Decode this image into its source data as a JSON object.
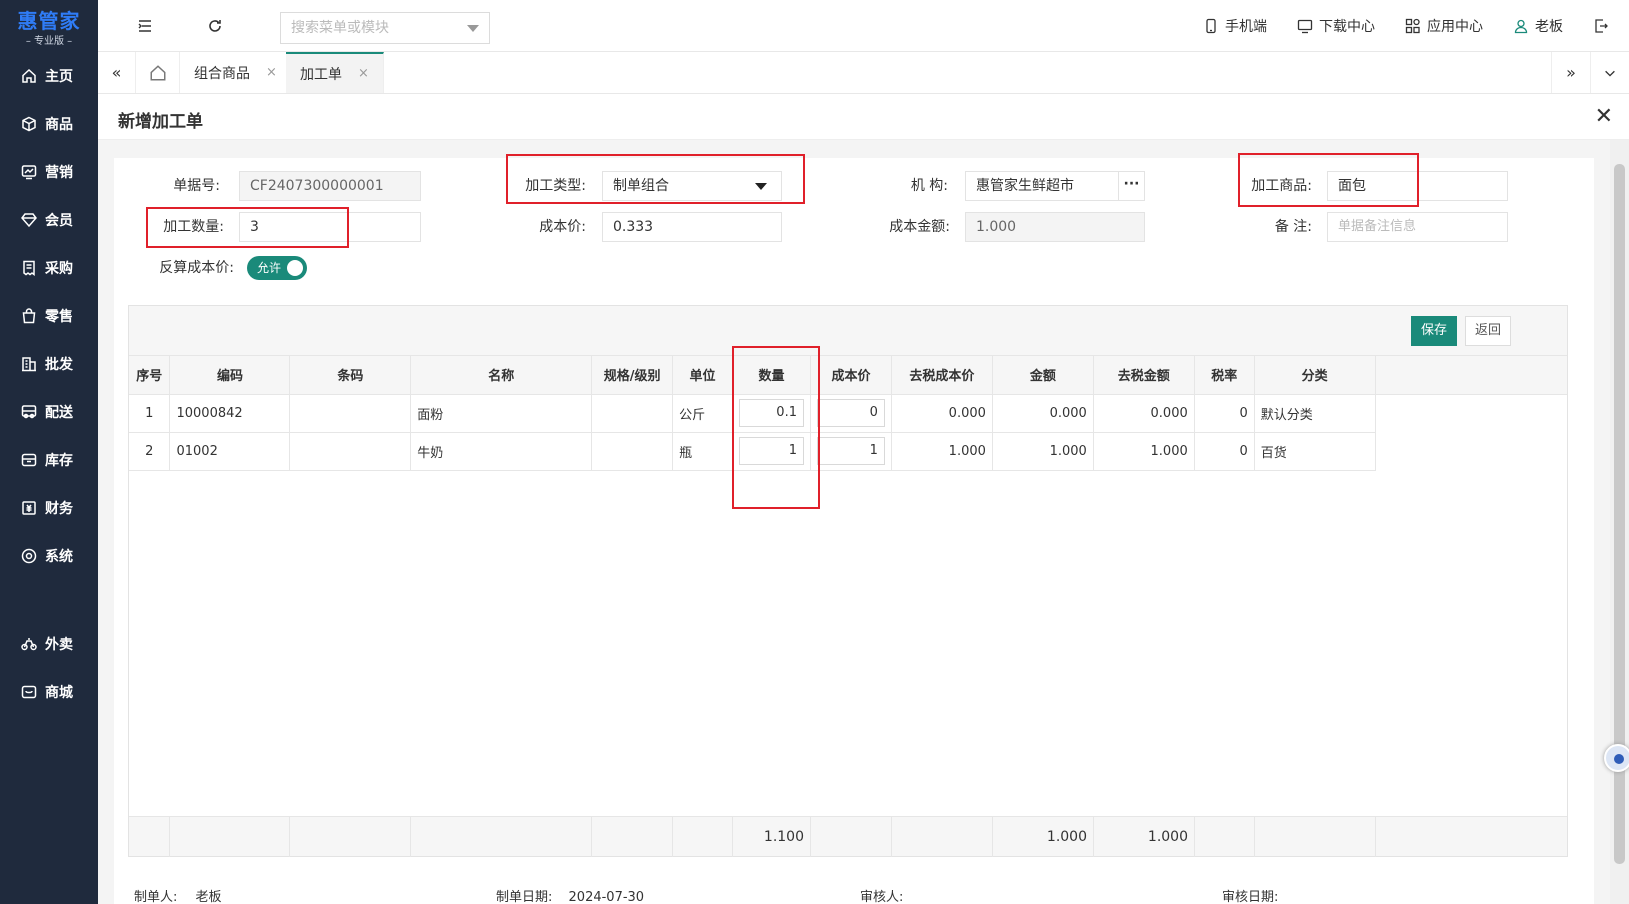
{
  "app": {
    "logo_main": "惠管家",
    "logo_sub": "专业版"
  },
  "sidebar": {
    "items": [
      {
        "label": "主页",
        "icon": "home-icon"
      },
      {
        "label": "商品",
        "icon": "box-icon"
      },
      {
        "label": "营销",
        "icon": "chart-icon"
      },
      {
        "label": "会员",
        "icon": "diamond-icon"
      },
      {
        "label": "采购",
        "icon": "receipt-icon"
      },
      {
        "label": "零售",
        "icon": "bag-icon"
      },
      {
        "label": "批发",
        "icon": "building-icon"
      },
      {
        "label": "配送",
        "icon": "truck-icon"
      },
      {
        "label": "库存",
        "icon": "archive-icon"
      },
      {
        "label": "财务",
        "icon": "money-icon"
      },
      {
        "label": "系统",
        "icon": "gear-icon"
      },
      {
        "label": "外卖",
        "icon": "bike-icon"
      },
      {
        "label": "商城",
        "icon": "store-icon"
      }
    ]
  },
  "topbar": {
    "search_placeholder": "搜索菜单或模块",
    "mobile": "手机端",
    "download": "下载中心",
    "apps": "应用中心",
    "user": "老板"
  },
  "tabs": [
    {
      "label": "组合商品"
    },
    {
      "label": "加工单"
    }
  ],
  "page": {
    "title": "新增加工单"
  },
  "form": {
    "doc_no_label": "单据号:",
    "doc_no": "CF2407300000001",
    "type_label": "加工类型:",
    "type_value": "制单组合",
    "org_label": "机 构:",
    "org_value": "惠管家生鲜超市",
    "product_label": "加工商品:",
    "product_value": "面包",
    "qty_label": "加工数量:",
    "qty_value": "3",
    "cost_label": "成本价:",
    "cost_value": "0.333",
    "cost_amount_label": "成本金额:",
    "cost_amount_value": "1.000",
    "remark_label": "备 注:",
    "remark_placeholder": "单据备注信息",
    "reverse_label": "反算成本价:",
    "reverse_toggle": "允许"
  },
  "actions": {
    "save": "保存",
    "back": "返回"
  },
  "table": {
    "headers": [
      "序号",
      "编码",
      "条码",
      "名称",
      "规格/级别",
      "单位",
      "数量",
      "成本价",
      "去税成本价",
      "金额",
      "去税金额",
      "税率",
      "分类"
    ],
    "rows": [
      {
        "no": "1",
        "code": "10000842",
        "barcode": "",
        "name": "面粉",
        "spec": "",
        "unit": "公斤",
        "qty": "0.1",
        "cost": "0",
        "cost_ex_tax": "0.000",
        "amount": "0.000",
        "amount_ex_tax": "0.000",
        "tax": "0",
        "category": "默认分类"
      },
      {
        "no": "2",
        "code": "01002",
        "barcode": "",
        "name": "牛奶",
        "spec": "",
        "unit": "瓶",
        "qty": "1",
        "cost": "1",
        "cost_ex_tax": "1.000",
        "amount": "1.000",
        "amount_ex_tax": "1.000",
        "tax": "0",
        "category": "百货"
      }
    ],
    "totals": {
      "qty": "1.100",
      "amount": "1.000",
      "amount_ex_tax": "1.000"
    }
  },
  "footer": {
    "maker_label": "制单人:",
    "maker": "老板",
    "date_label": "制单日期:",
    "date": "2024-07-30",
    "auditor_label": "审核人:",
    "audit_date_label": "审核日期:"
  },
  "colors": {
    "accent": "#1a8a7a",
    "sidebar": "#1f2a3d",
    "highlight": "#e0202a"
  }
}
